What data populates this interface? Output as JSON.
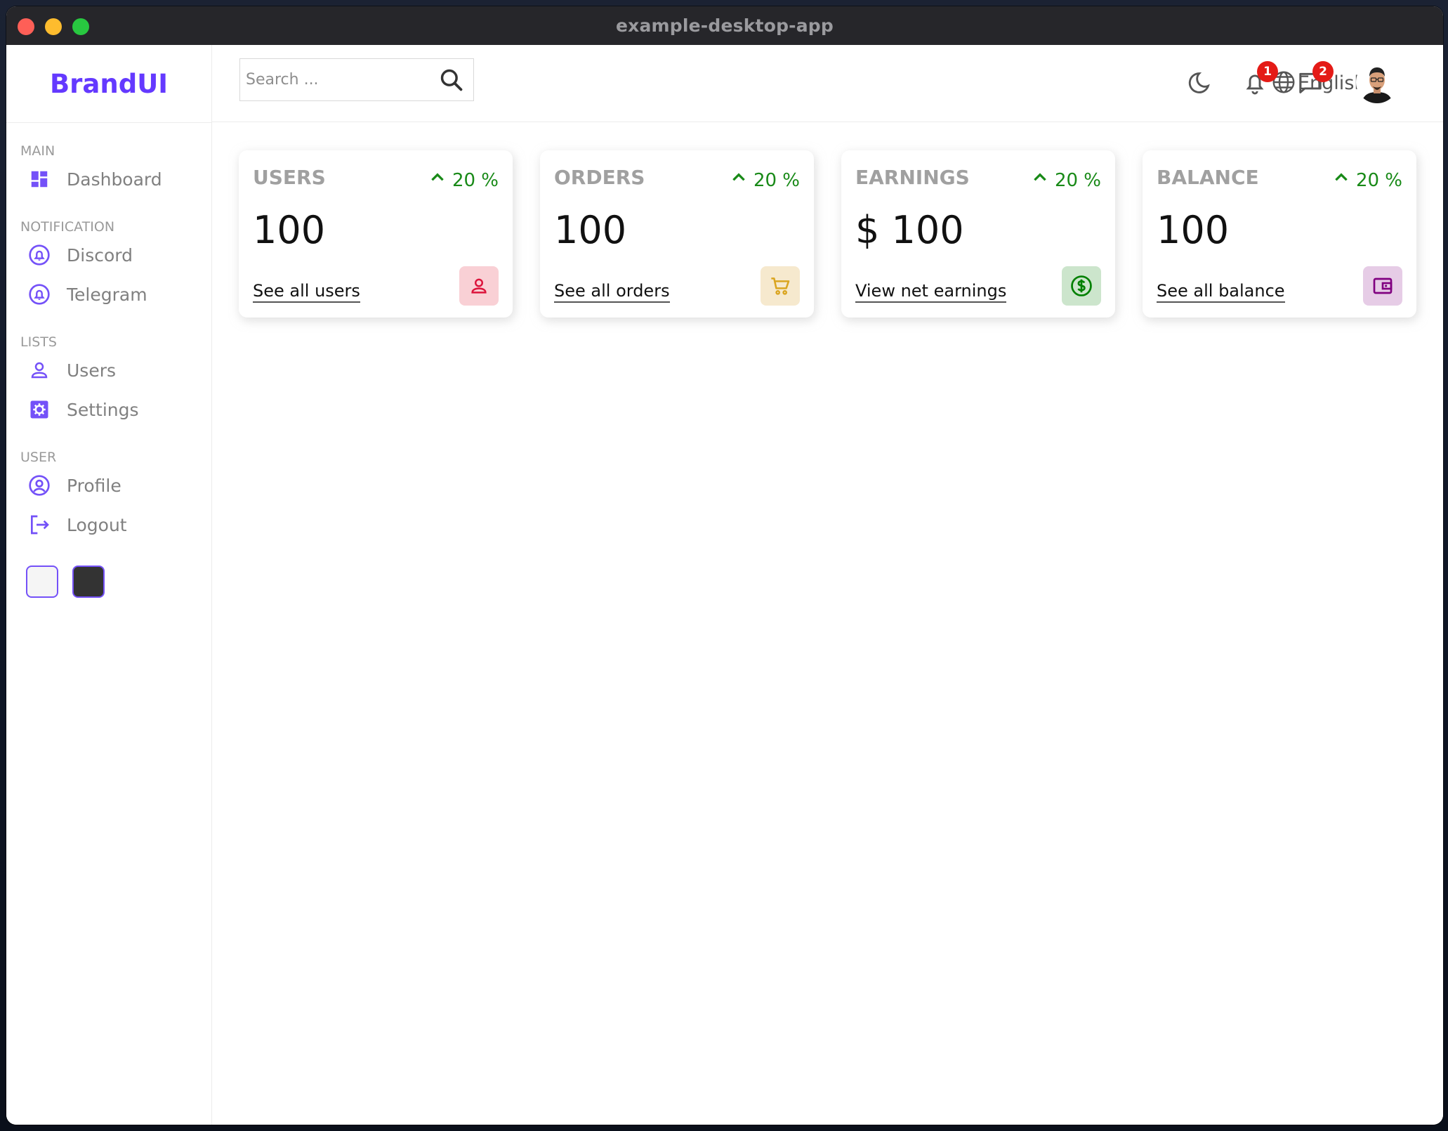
{
  "window": {
    "title": "example-desktop-app"
  },
  "brand": {
    "name": "BrandUI",
    "color": "#6439ff"
  },
  "search": {
    "placeholder": "Search ..."
  },
  "navbar": {
    "language": "English",
    "notifications_count": "1",
    "messages_count": "2"
  },
  "sidebar": {
    "sections": [
      {
        "title": "MAIN",
        "items": [
          {
            "label": "Dashboard",
            "icon": "dashboard-icon"
          }
        ]
      },
      {
        "title": "NOTIFICATION",
        "items": [
          {
            "label": "Discord",
            "icon": "notification-bell-circle-icon"
          },
          {
            "label": "Telegram",
            "icon": "notification-bell-circle-icon"
          }
        ]
      },
      {
        "title": "LISTS",
        "items": [
          {
            "label": "Users",
            "icon": "person-icon"
          },
          {
            "label": "Settings",
            "icon": "settings-gear-icon"
          }
        ]
      },
      {
        "title": "USER",
        "items": [
          {
            "label": "Profile",
            "icon": "account-circle-icon"
          },
          {
            "label": "Logout",
            "icon": "logout-icon"
          }
        ]
      }
    ],
    "color_options": [
      "#f5f5f5",
      "#333333"
    ]
  },
  "widgets": [
    {
      "title": "USERS",
      "percentage": "20 %",
      "counter": "100",
      "link": "See all users",
      "icon": "person-outline-icon",
      "icon_color": "#dc143c",
      "icon_bg": "#f9d0d5"
    },
    {
      "title": "ORDERS",
      "percentage": "20 %",
      "counter": "100",
      "link": "See all orders",
      "icon": "shopping-cart-icon",
      "icon_color": "#daa520",
      "icon_bg": "#f6e9ce"
    },
    {
      "title": "EARNINGS",
      "percentage": "20 %",
      "counter": "$ 100",
      "link": "View net earnings",
      "icon": "dollar-circle-icon",
      "icon_color": "#008000",
      "icon_bg": "#cce5cc"
    },
    {
      "title": "BALANCE",
      "percentage": "20 %",
      "counter": "100",
      "link": "See all balance",
      "icon": "wallet-icon",
      "icon_color": "#800080",
      "icon_bg": "#e6cce6"
    }
  ],
  "colors": {
    "accent": "#7451f8",
    "positive": "#198a18",
    "badge": "#e41b17"
  }
}
